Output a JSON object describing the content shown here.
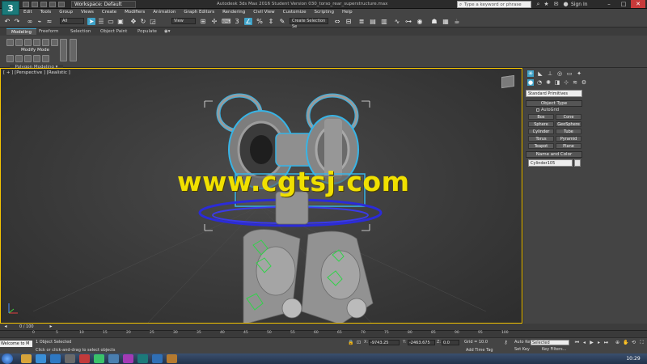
{
  "app": {
    "logo": "3",
    "workspace": "Workspace: Default",
    "window_title": "Autodesk 3ds Max 2016   Student Version   030_torso_rear_superstructure.max",
    "search_placeholder": "Type a keyword or phrase",
    "signin": "Sign In"
  },
  "menu": [
    "Edit",
    "Tools",
    "Group",
    "Views",
    "Create",
    "Modifiers",
    "Animation",
    "Graph Editors",
    "Rendering",
    "Civil View",
    "Customize",
    "Scripting",
    "Help"
  ],
  "toolbar": {
    "selection_filter": "All",
    "ref_coord": "View",
    "named_selection": "Create Selection Se"
  },
  "ribbon": {
    "tabs": [
      "Modeling",
      "Freeform",
      "Selection",
      "Object Paint",
      "Populate"
    ],
    "modify_mode": "Modify Mode",
    "polygon_modeling": "Polygon Modeling ▾"
  },
  "viewport": {
    "label": "[ + ] [Perspective ] [Realistic ]",
    "watermark": "www.cgtsj.com"
  },
  "command_panel": {
    "category": "Standard Primitives",
    "object_type_title": "Object Type",
    "autogrid": "AutoGrid",
    "primitives": [
      "Box",
      "Cone",
      "Sphere",
      "GeoSphere",
      "Cylinder",
      "Tube",
      "Torus",
      "Pyramid",
      "Teapot",
      "Plane"
    ],
    "name_color_title": "Name and Color",
    "object_name": "Cylinder105",
    "swatch_color": "#e5e5e5"
  },
  "timeline": {
    "frame": "0 / 100",
    "ticks": [
      "0",
      "5",
      "10",
      "15",
      "20",
      "25",
      "30",
      "35",
      "40",
      "45",
      "50",
      "55",
      "60",
      "65",
      "70",
      "75",
      "80",
      "85",
      "90",
      "95",
      "100"
    ]
  },
  "status": {
    "maxscript": "Welcome to M",
    "selected": "1 Object Selected",
    "prompt": "Click or click-and-drag to select objects",
    "x_value": "-9743.25",
    "y_value": "-2463.675",
    "z_value": "0.0",
    "grid": "Grid = 10.0",
    "add_time_tag": "Add Time Tag",
    "auto_key": "Auto Key",
    "set_key": "Set Key",
    "selected_set": "Selected",
    "key_filters": "Key Filters..."
  },
  "taskbar": {
    "clock": "10:29"
  },
  "colors": {
    "accent": "#3fa3c9",
    "viewport_border": "#f4c400",
    "watermark": "#f0e000",
    "selection_highlight": "#37b4e6"
  }
}
